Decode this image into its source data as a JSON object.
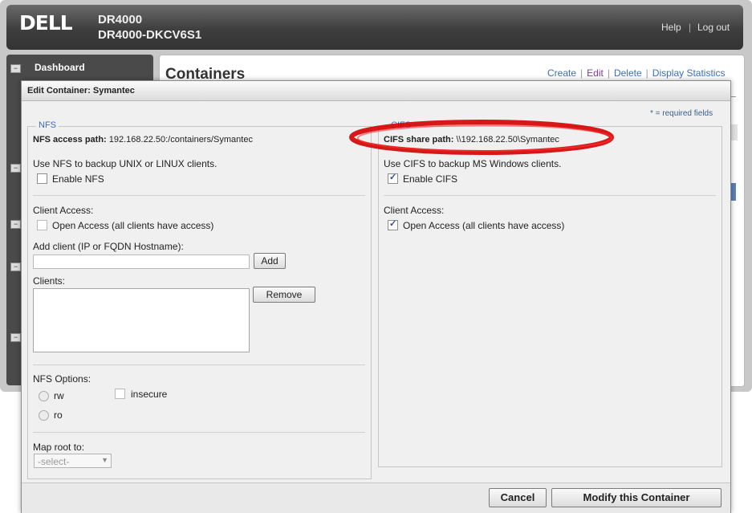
{
  "app": {
    "brand": "DELL",
    "system_model": "DR4000",
    "system_name": "DR4000-DKCV6S1",
    "help_label": "Help",
    "separator": "|",
    "logout_label": "Log out"
  },
  "sidebar": {
    "dashboard_label": "Dashboard",
    "toggle_symbol": "−"
  },
  "main": {
    "title": "Containers",
    "actions": {
      "create": "Create",
      "edit": "Edit",
      "delete": "Delete",
      "display_statistics": "Display Statistics",
      "separator": "|"
    }
  },
  "dialog": {
    "title": "Edit Container: Symantec",
    "required_note": "* = required fields",
    "nfs": {
      "legend": "NFS",
      "access_path_label": "NFS access path:",
      "access_path_value": "192.168.22.50:/containers/Symantec",
      "description": "Use NFS to backup UNIX or LINUX clients.",
      "enable_label": "Enable NFS",
      "enable_checked": false,
      "client_access_label": "Client Access:",
      "open_access_label": "Open Access (all clients have access)",
      "open_access_checked": false,
      "add_client_label": "Add client (IP or FQDN Hostname):",
      "add_client_value": "",
      "add_button": "Add",
      "clients_label": "Clients:",
      "clients": [],
      "remove_button": "Remove",
      "options_label": "NFS Options:",
      "option_rw": "rw",
      "option_ro": "ro",
      "option_insecure": "insecure",
      "map_root_label": "Map root to:",
      "map_root_value": "-select-"
    },
    "cifs": {
      "legend": "CIFS",
      "share_path_label": "CIFS share path:",
      "share_path_value": "\\\\192.168.22.50\\Symantec",
      "description": "Use CIFS to backup MS Windows clients.",
      "enable_label": "Enable CIFS",
      "enable_checked": true,
      "client_access_label": "Client Access:",
      "open_access_label": "Open Access (all clients have access)",
      "open_access_checked": true
    },
    "buttons": {
      "cancel": "Cancel",
      "modify": "Modify this Container"
    }
  },
  "colors": {
    "link": "#3b6fb6",
    "legend": "#3d6db3",
    "highlight_ellipse": "#d40000"
  }
}
